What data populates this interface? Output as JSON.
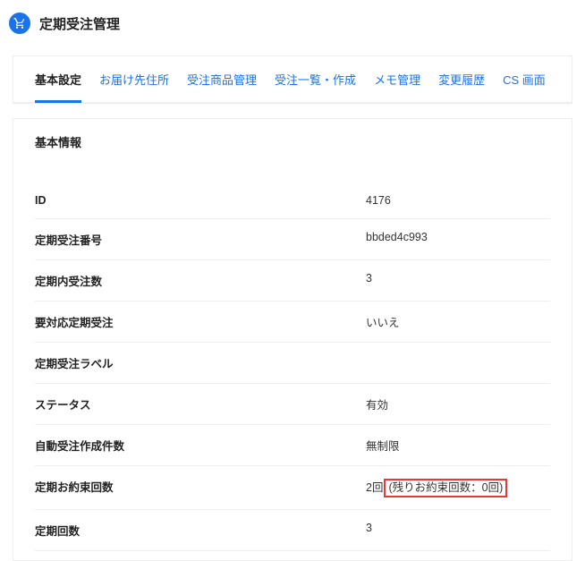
{
  "header": {
    "title": "定期受注管理"
  },
  "tabs": [
    {
      "label": "基本設定",
      "active": true
    },
    {
      "label": "お届け先住所",
      "active": false
    },
    {
      "label": "受注商品管理",
      "active": false
    },
    {
      "label": "受注一覧・作成",
      "active": false
    },
    {
      "label": "メモ管理",
      "active": false
    },
    {
      "label": "変更履歴",
      "active": false
    },
    {
      "label": "CS 画面",
      "active": false
    }
  ],
  "section": {
    "title": "基本情報"
  },
  "rows": [
    {
      "label": "ID",
      "value": "4176"
    },
    {
      "label": "定期受注番号",
      "value": "bbded4c993"
    },
    {
      "label": "定期内受注数",
      "value": "3"
    },
    {
      "label": "要対応定期受注",
      "value": "いいえ"
    },
    {
      "label": "定期受注ラベル",
      "value": ""
    },
    {
      "label": "ステータス",
      "value": "有効"
    },
    {
      "label": "自動受注作成件数",
      "value": "無制限"
    },
    {
      "label": "定期お約束回数",
      "value": "2回",
      "highlight": "(残りお約束回数：0回)"
    },
    {
      "label": "定期回数",
      "value": "3"
    }
  ]
}
